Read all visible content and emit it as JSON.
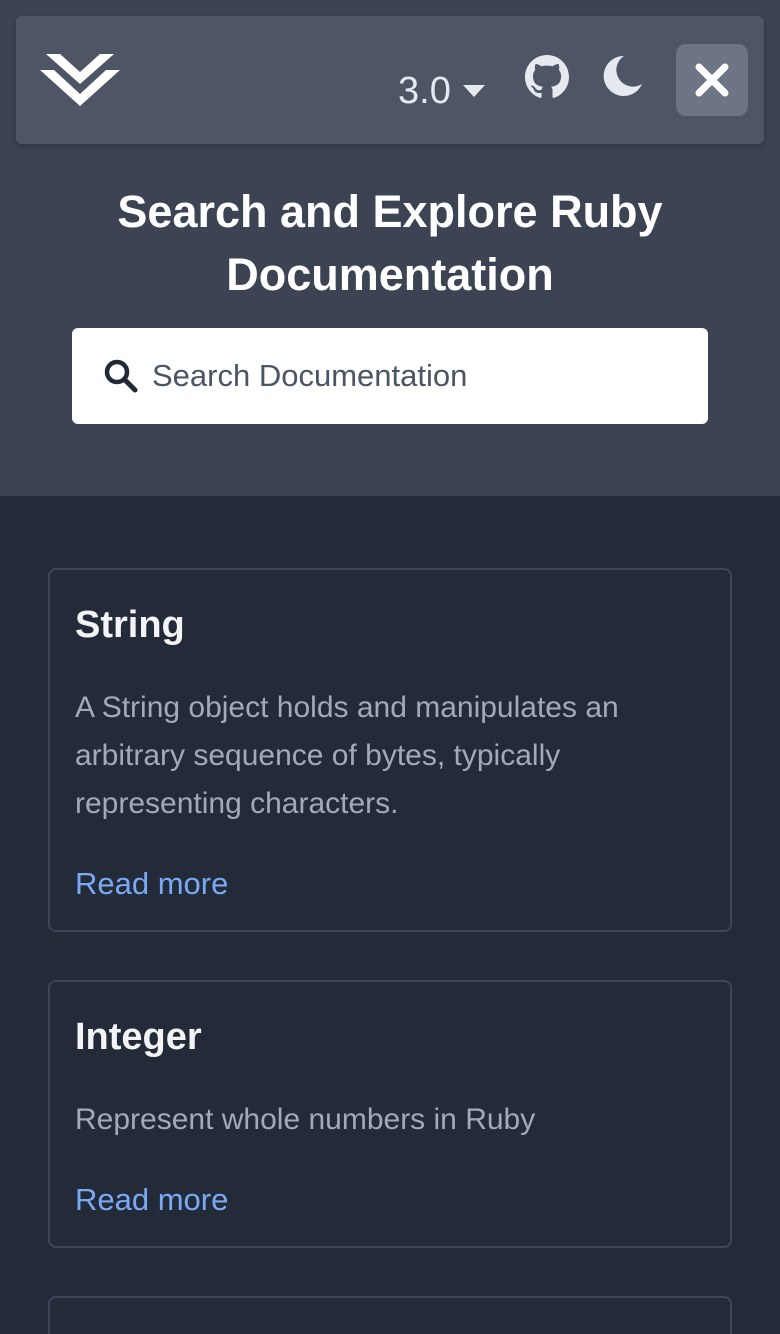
{
  "header": {
    "version": "3.0",
    "icons": {
      "logo": "chevron-logo-icon",
      "version_caret": "caret-down-icon",
      "github": "github-icon",
      "theme": "moon-icon",
      "close": "close-icon"
    }
  },
  "hero": {
    "title": "Search and Explore Ruby Documentation"
  },
  "search": {
    "placeholder": "Search Documentation",
    "value": "",
    "icon": "search-icon"
  },
  "cards": [
    {
      "title": "String",
      "description": "A String object holds and manipulates an arbitrary sequence of bytes, typically representing characters.",
      "link": "Read more"
    },
    {
      "title": "Integer",
      "description": "Represent whole numbers in Ruby",
      "link": "Read more"
    }
  ],
  "colors": {
    "page_background": "#232a38",
    "hero_background": "#3c4353",
    "topbar_background": "#4e5565",
    "link": "#7aa9f5"
  }
}
